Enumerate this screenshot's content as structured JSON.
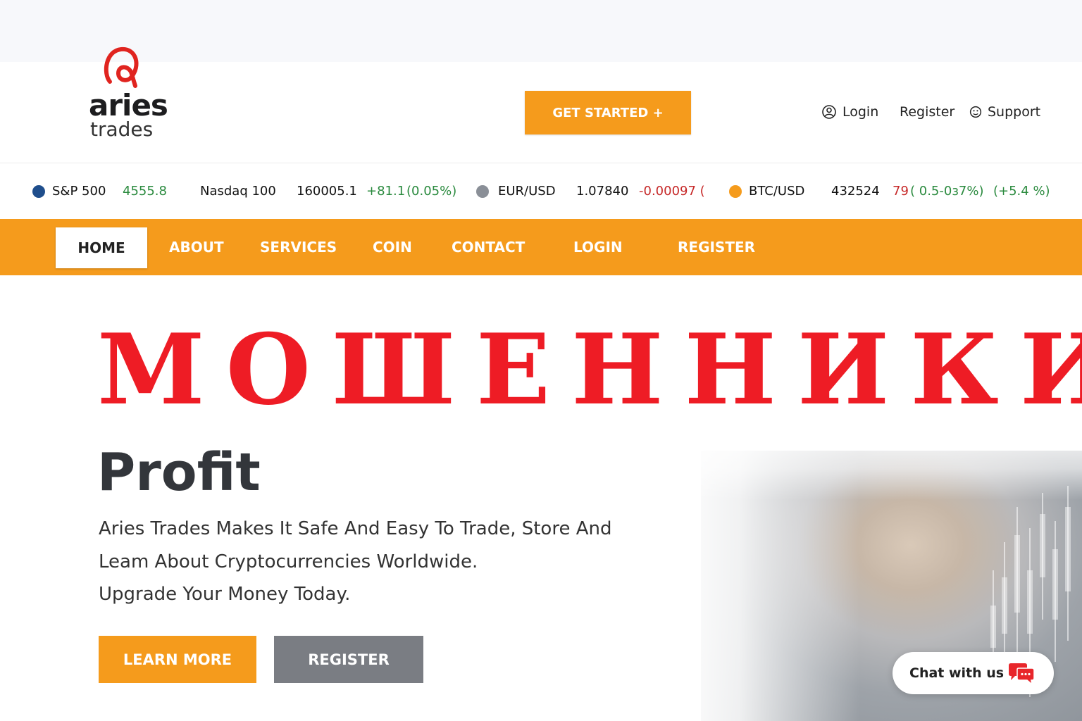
{
  "brand": {
    "name": "aries",
    "tagline": "trades",
    "accent": "#f59b1c",
    "logo_color": "#e0241f"
  },
  "header": {
    "cta_label": "GET STARTED +",
    "links": {
      "login": "Login",
      "register": "Register",
      "support": "Support"
    }
  },
  "ticker": [
    {
      "symbol": "S&P 500",
      "price": "4555.8",
      "icon": "sp500-icon"
    },
    {
      "symbol": "Nasdaq 100",
      "price": "160005.1",
      "change": "+81.1",
      "percent": "(0.05%)"
    },
    {
      "symbol": "EUR/USD",
      "price": "1.07840",
      "change": "-0.00097 (",
      "icon": "eur-icon"
    },
    {
      "symbol": "BTC/USD",
      "price": "432524",
      "change": "79",
      "percent": "( 0.5-0з7%)",
      "extra": "(+5.4 %)",
      "icon": "btc-icon"
    }
  ],
  "nav": {
    "items": [
      "HOME",
      "ABOUT",
      "SERVICES",
      "COIN",
      "CONTACT",
      "LOGIN",
      "REGISTER"
    ],
    "active": "HOME"
  },
  "hero": {
    "warning": "МОШЕННИКИ",
    "warning_color": "#ee1c25",
    "title": "Profit",
    "lines": [
      "Aries Trades Makes It Safe And Easy To Trade, Store And",
      "Leam About Cryptocurrencies Worldwide.",
      "Upgrade Your Money Today."
    ],
    "learn_more": "LEARN MORE",
    "register": "REGISTER"
  },
  "chat": {
    "label": "Chat with us",
    "icon": "chat-bubbles-icon",
    "icon_color": "#e8262b"
  }
}
